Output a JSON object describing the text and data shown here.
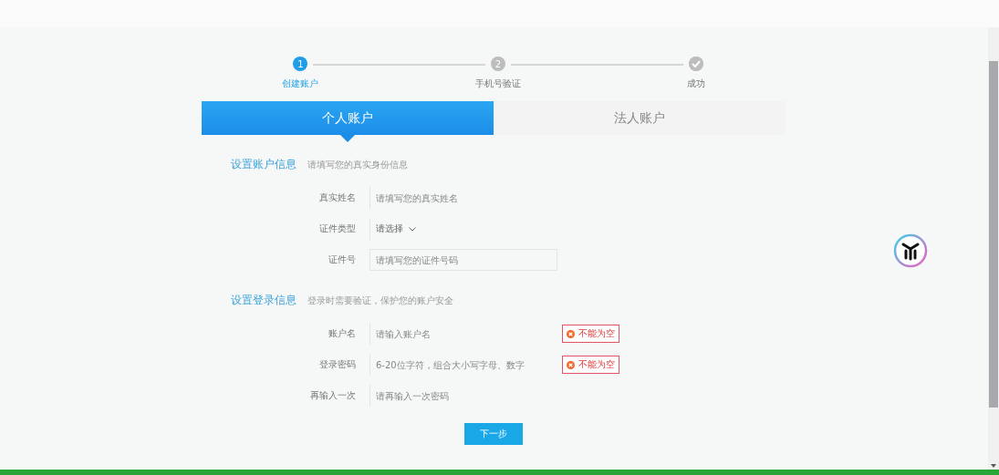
{
  "steps": [
    {
      "number": "1",
      "label": "创建账户",
      "selected": true
    },
    {
      "number": "2",
      "label": "手机号验证",
      "selected": false
    },
    {
      "label": "成功",
      "selected": false
    }
  ],
  "tabs": [
    {
      "label": "个人账户",
      "selected": true
    },
    {
      "label": "法人账户",
      "selected": false
    }
  ],
  "sections": [
    {
      "title": "设置账户信息",
      "hint": "请填写您的真实身份信息",
      "fields": [
        {
          "kind": "text",
          "label": "真实姓名",
          "placeholder": "请填写您的真实姓名"
        },
        {
          "kind": "select",
          "label": "证件类型",
          "value": "请选择"
        },
        {
          "kind": "text",
          "label": "证件号",
          "placeholder": "请填写您的证件号码",
          "boxed": true
        }
      ]
    },
    {
      "title": "设置登录信息",
      "hint": "登录时需要验证，保护您的账户安全",
      "fields": [
        {
          "kind": "text",
          "label": "账户名",
          "placeholder": "请输入账户名",
          "error": "不能为空"
        },
        {
          "kind": "text",
          "label": "登录密码",
          "placeholder": "6-20位字符，组合大小写字母、数字",
          "error": "不能为空"
        },
        {
          "kind": "text",
          "label": "再输入一次",
          "placeholder": "请再输入一次密码"
        }
      ]
    }
  ],
  "next_button": "下一步"
}
